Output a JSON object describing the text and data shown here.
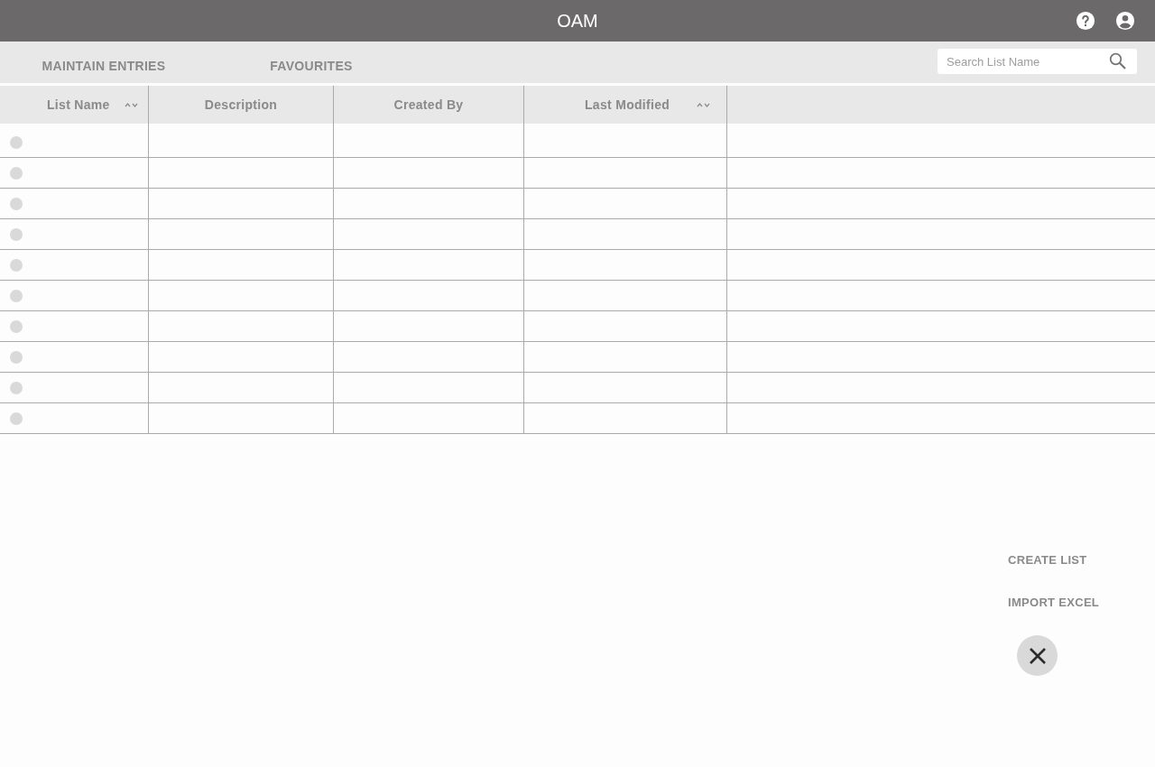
{
  "header": {
    "title": "OAM"
  },
  "tabs": [
    {
      "label": "MAINTAIN ENTRIES"
    },
    {
      "label": "FAVOURITES"
    }
  ],
  "search": {
    "placeholder": "Search List Name"
  },
  "table": {
    "columns": [
      {
        "label": "List Name",
        "sortable": true
      },
      {
        "label": "Description",
        "sortable": false
      },
      {
        "label": "Created By",
        "sortable": false
      },
      {
        "label": "Last Modified",
        "sortable": true
      }
    ],
    "rows": [
      {
        "selected": false
      },
      {
        "selected": false
      },
      {
        "selected": false
      },
      {
        "selected": false
      },
      {
        "selected": false
      },
      {
        "selected": false
      },
      {
        "selected": false
      },
      {
        "selected": false
      },
      {
        "selected": false
      },
      {
        "selected": false
      }
    ]
  },
  "speed_dial": {
    "open": true,
    "actions": [
      "CREATE LIST",
      "IMPORT EXCEL"
    ]
  }
}
